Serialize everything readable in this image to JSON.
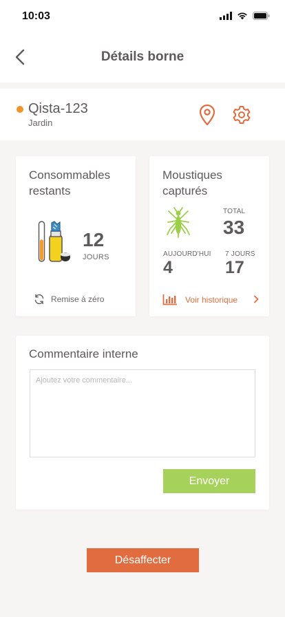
{
  "status_bar": {
    "time": "10:03"
  },
  "header": {
    "title": "Détails borne",
    "back_icon": "chevron-left-icon"
  },
  "device": {
    "name": "Qista-123",
    "location": "Jardin",
    "status_color": "#f0932b",
    "actions": [
      "map-pin-icon",
      "gear-icon"
    ]
  },
  "consumables": {
    "title_line1": "Consommables",
    "title_line2": "restants",
    "days_value": "12",
    "days_unit": "JOURS",
    "level_fraction": 0.55,
    "reset_label": "Remise à zéro"
  },
  "mosquitoes": {
    "title_line1": "Moustiques",
    "title_line2": "capturés",
    "total_label": "TOTAL",
    "total_value": "33",
    "today_label": "AUJOURD'HUI",
    "today_value": "4",
    "week_label": "7 JOURS",
    "week_value": "17",
    "history_label": "Voir historique"
  },
  "comment": {
    "title": "Commentaire interne",
    "placeholder": "Ajoutez votre commentaire...",
    "value": "",
    "send_label": "Envoyer"
  },
  "footer": {
    "unassign_label": "Désaffecter"
  },
  "colors": {
    "accent_orange": "#e06c3f",
    "status_orange": "#f0932b",
    "send_green": "#a6d15a",
    "bottle_yellow": "#f2d21f",
    "level_orange": "#f59a2b",
    "mosquito_green": "#9ccf4a"
  }
}
